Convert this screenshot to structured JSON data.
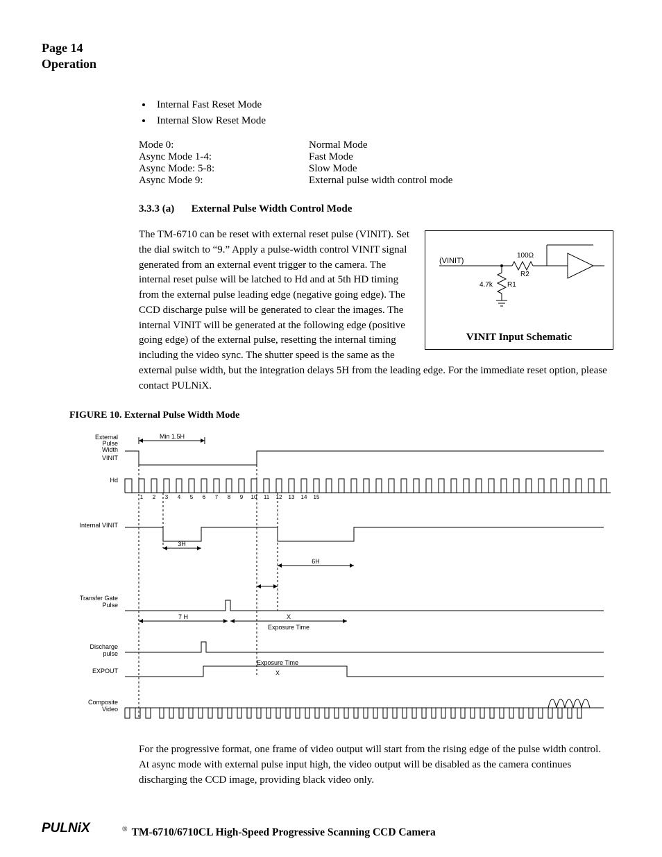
{
  "header": {
    "page_num": "Page 14",
    "section": "Operation"
  },
  "bullets": [
    "Internal Fast Reset Mode",
    "Internal Slow Reset Mode"
  ],
  "modes": [
    {
      "left": "Mode 0:",
      "right": "Normal Mode"
    },
    {
      "left": "Async Mode 1-4:",
      "right": "Fast Mode"
    },
    {
      "left": "Async Mode: 5-8:",
      "right": "Slow Mode"
    },
    {
      "left": "Async Mode 9:",
      "right": "External pulse width control mode"
    }
  ],
  "section": {
    "num": "3.3.3 (a)",
    "title": "External Pulse Width Control Mode"
  },
  "schematic": {
    "caption": "VINIT Input Schematic",
    "labels": {
      "vinit": "(VINIT)",
      "r100": "100Ω",
      "r2": "R2",
      "r47": "4.7k",
      "r1": "R1"
    }
  },
  "para1": "The TM-6710 can be reset with external reset pulse (VINIT). Set the dial switch to “9.” Apply a pulse-width control VINIT signal generated from an external event trigger to the camera. The internal reset pulse will be latched to Hd and at 5th HD timing from the external pulse leading edge (negative going edge). The CCD discharge pulse will be generated to clear the images. The internal VINIT will be generated at the following edge (positive going edge) of the external pulse, resetting the internal timing including the video sync. The shutter speed is the same as the external pulse width, but the integration delays 5H from the leading edge. For the immediate reset option, please contact PULNiX.",
  "figure": {
    "num": "FIGURE 10.",
    "title": "External Pulse Width Mode"
  },
  "timing_labels": {
    "ext_pulse": "External\nPulse\nWidth",
    "vinit": "VINIT",
    "hd": "Hd",
    "internal_vinit": "Internal VINIT",
    "transfer_gate": "Transfer Gate\nPulse",
    "discharge": "Discharge\npulse",
    "expout": "EXPOUT",
    "composite": "Composite\nVideo",
    "min15h": "Min 1.5H",
    "h3": "3H",
    "h6": "6H",
    "h7": "7 H",
    "x": "X",
    "exposure": "Exposure Time",
    "exposure2": "Exposure Time\nX",
    "hd_numbers": [
      "1",
      "2",
      "3",
      "4",
      "5",
      "6",
      "7",
      "8",
      "9",
      "10",
      "11",
      "12",
      "13",
      "14",
      "15"
    ]
  },
  "para2": "For the progressive format, one frame of video output will start from the rising edge of the pulse width control. At async mode with external pulse input high, the video output will be disabled as the camera continues discharging the CCD image, providing black video only.",
  "footer": {
    "logo": "PULNiX",
    "reg": "®",
    "title": "TM-6710/6710CL High-Speed Progressive Scanning CCD Camera"
  }
}
